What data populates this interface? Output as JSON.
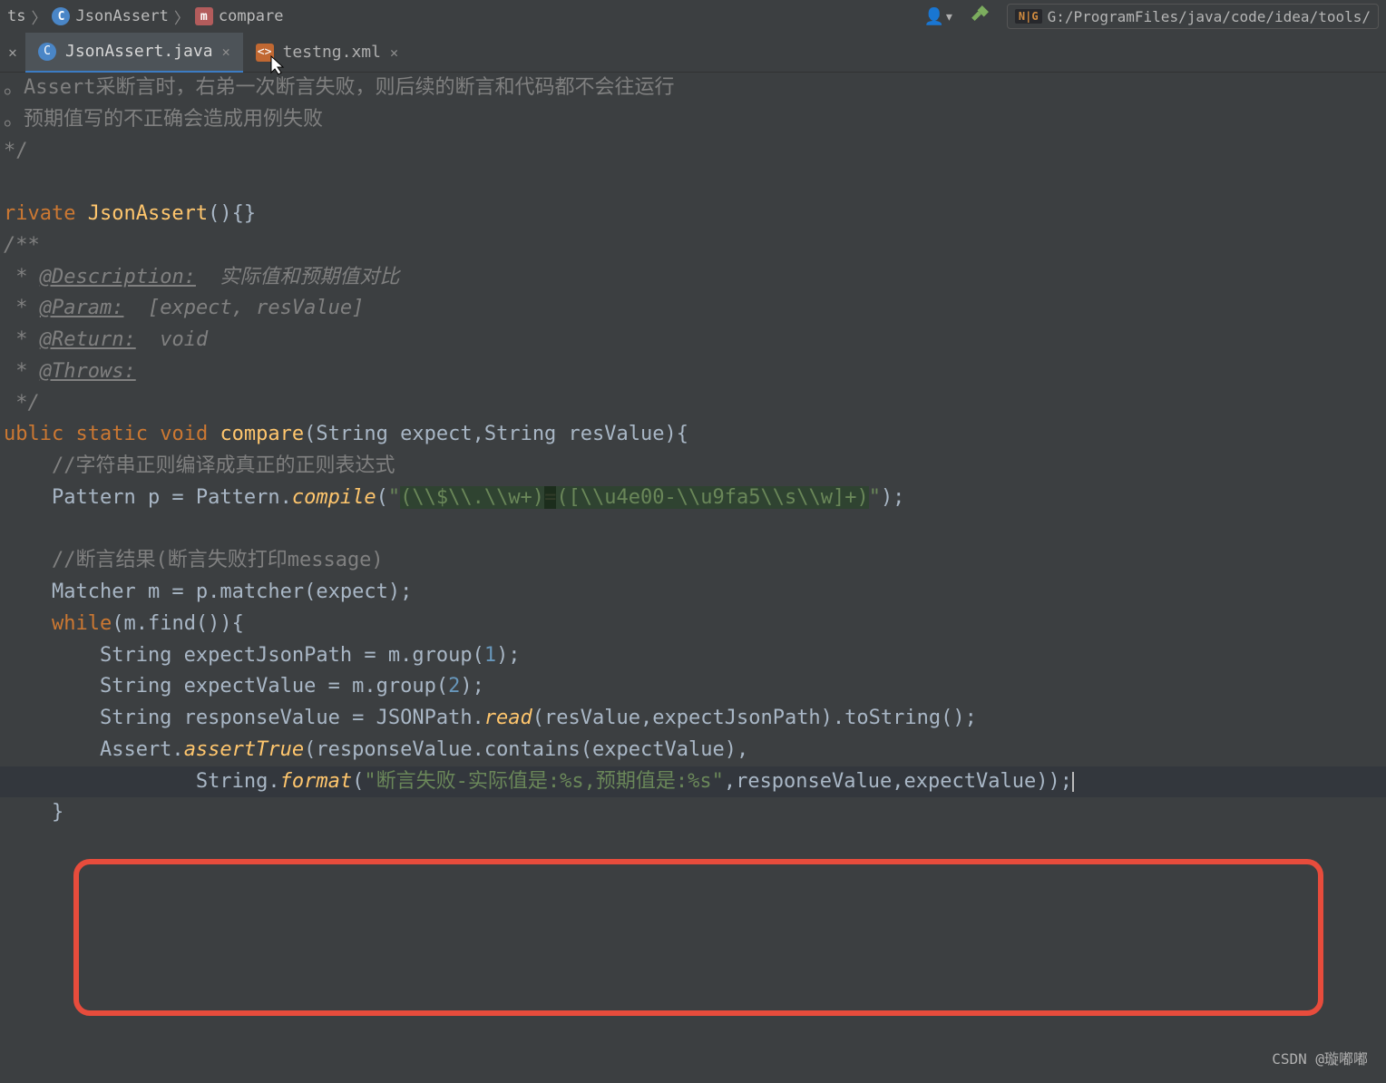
{
  "breadcrumbs": {
    "class_name": "JsonAssert",
    "method_name": "compare"
  },
  "path": "G:/ProgramFiles/java/code/idea/tools/",
  "tabs": [
    {
      "name": "JsonAssert.java"
    },
    {
      "name": "testng.xml"
    }
  ],
  "code": {
    "line1": "。Assert采断言时，右弟一次断言失败，则后续的断言和代码都不会往运行",
    "line2": "。预期值写的不正确会造成用例失败",
    "line3": "*/",
    "line5_kw": "rivate ",
    "line5_type": "JsonAssert",
    "line5_rest": "(){}",
    "line6": "/**",
    "line7_tag": "@Description:",
    "line7_txt": "  实际值和预期值对比",
    "line8_tag": "@Param:",
    "line8_txt": "  [expect, resValue]",
    "line9_tag": "@Return:",
    "line9_txt": "  void",
    "line10_tag": "@Throws:",
    "line11": " */",
    "line12_p1": "ublic ",
    "line12_p2": "static ",
    "line12_p3": "void ",
    "line12_fn": "compare",
    "line12_p4": "(String expect,String resValue){",
    "line13": "    //字符串正则编译成真正的正则表达式",
    "line14_a": "    Pattern p = Pattern.",
    "line14_fn": "compile",
    "line14_q": "(",
    "line14_s1": "\"",
    "line14_s2": "(\\\\$\\\\.\\\\w+)",
    "line14_s3": "=",
    "line14_s4": "([\\\\u4e00-\\\\u9fa5\\\\s\\\\w]+)",
    "line14_s5": "\"",
    "line14_e": ");",
    "line16": "    //断言结果(断言失败打印message)",
    "line17": "    Matcher m = p.matcher(expect);",
    "line18_kw": "while",
    "line18_rest": "(m.find()){",
    "line19_a": "        String expectJsonPath = m.group(",
    "line19_n": "1",
    "line19_e": ");",
    "line20_a": "        String expectValue = m.group(",
    "line20_n": "2",
    "line20_e": ");",
    "line21_a": "        String responseValue = JSONPath.",
    "line21_fn": "read",
    "line21_b": "(resValue,expectJsonPath).toString();",
    "line22_a": "        Assert.",
    "line22_fn": "assertTrue",
    "line22_b": "(responseValue.contains(expectValue),",
    "line23_a": "                String.",
    "line23_fn": "format",
    "line23_b": "(",
    "line23_str": "\"断言失败-实际值是:%s,预期值是:%s\"",
    "line23_c": ",responseValue,expectValue));",
    "line24": "    }"
  },
  "watermark": "CSDN @璇嘟嘟"
}
